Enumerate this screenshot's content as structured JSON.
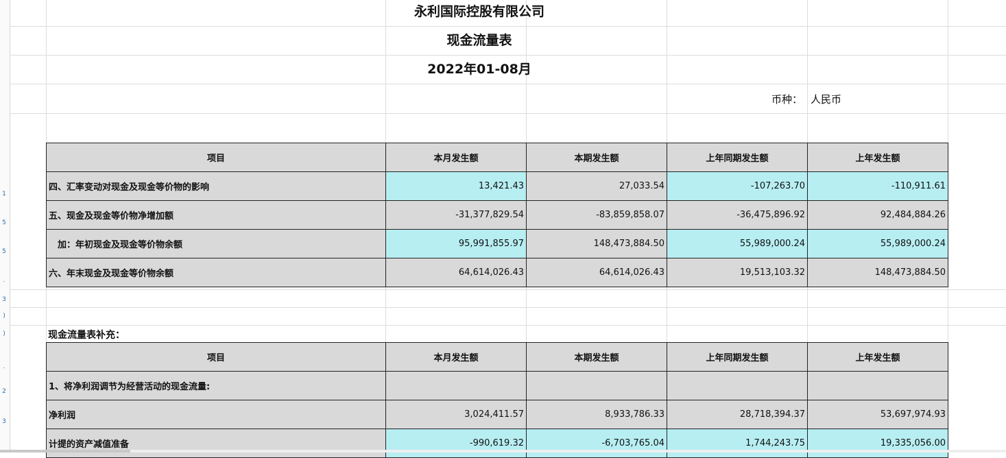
{
  "company_title": "永利国际控股有限公司",
  "statement_title": "现金流量表",
  "period": "2022年01-08月",
  "currency_label": "币种：",
  "currency_value": "人民币",
  "header": {
    "item": "项目",
    "this_month": "本月发生额",
    "this_period": "本期发生额",
    "prior_same_period": "上年同期发生额",
    "prior_year": "上年发生额"
  },
  "section1_rows": [
    {
      "label": "四、汇率变动对现金及现金等价物的影响",
      "v1": "13,421.43",
      "v2": "27,033.54",
      "v3": "-107,263.70",
      "v4": "-110,911.61"
    },
    {
      "label": "五、现金及现金等价物净增加额",
      "v1": "-31,377,829.54",
      "v2": "-83,859,858.07",
      "v3": "-36,475,896.92",
      "v4": "92,484,884.26"
    },
    {
      "label": "　加：年初现金及现金等价物余额",
      "v1": "95,991,855.97",
      "v2": "148,473,884.50",
      "v3": "55,989,000.24",
      "v4": "55,989,000.24"
    },
    {
      "label": "六、年末现金及现金等价物余额",
      "v1": "64,614,026.43",
      "v2": "64,614,026.43",
      "v3": "19,513,103.32",
      "v4": "148,473,884.50"
    }
  ],
  "supplement_title": "现金流量表补充：",
  "section2_rows": [
    {
      "label": "1、将净利润调节为经营活动的现金流量:",
      "v1": "",
      "v2": "",
      "v3": "",
      "v4": ""
    },
    {
      "label": "净利润",
      "v1": "3,024,411.57",
      "v2": "8,933,786.33",
      "v3": "28,718,394.37",
      "v4": "53,697,974.93"
    },
    {
      "label": "计提的资产减值准备",
      "v1": "-990,619.32",
      "v2": "-6,703,765.04",
      "v3": "1,744,243.75",
      "v4": "19,335,056.00"
    }
  ],
  "colors": {
    "header_gray": "#d9d9d9",
    "cell_cyan": "#b7eef2"
  }
}
